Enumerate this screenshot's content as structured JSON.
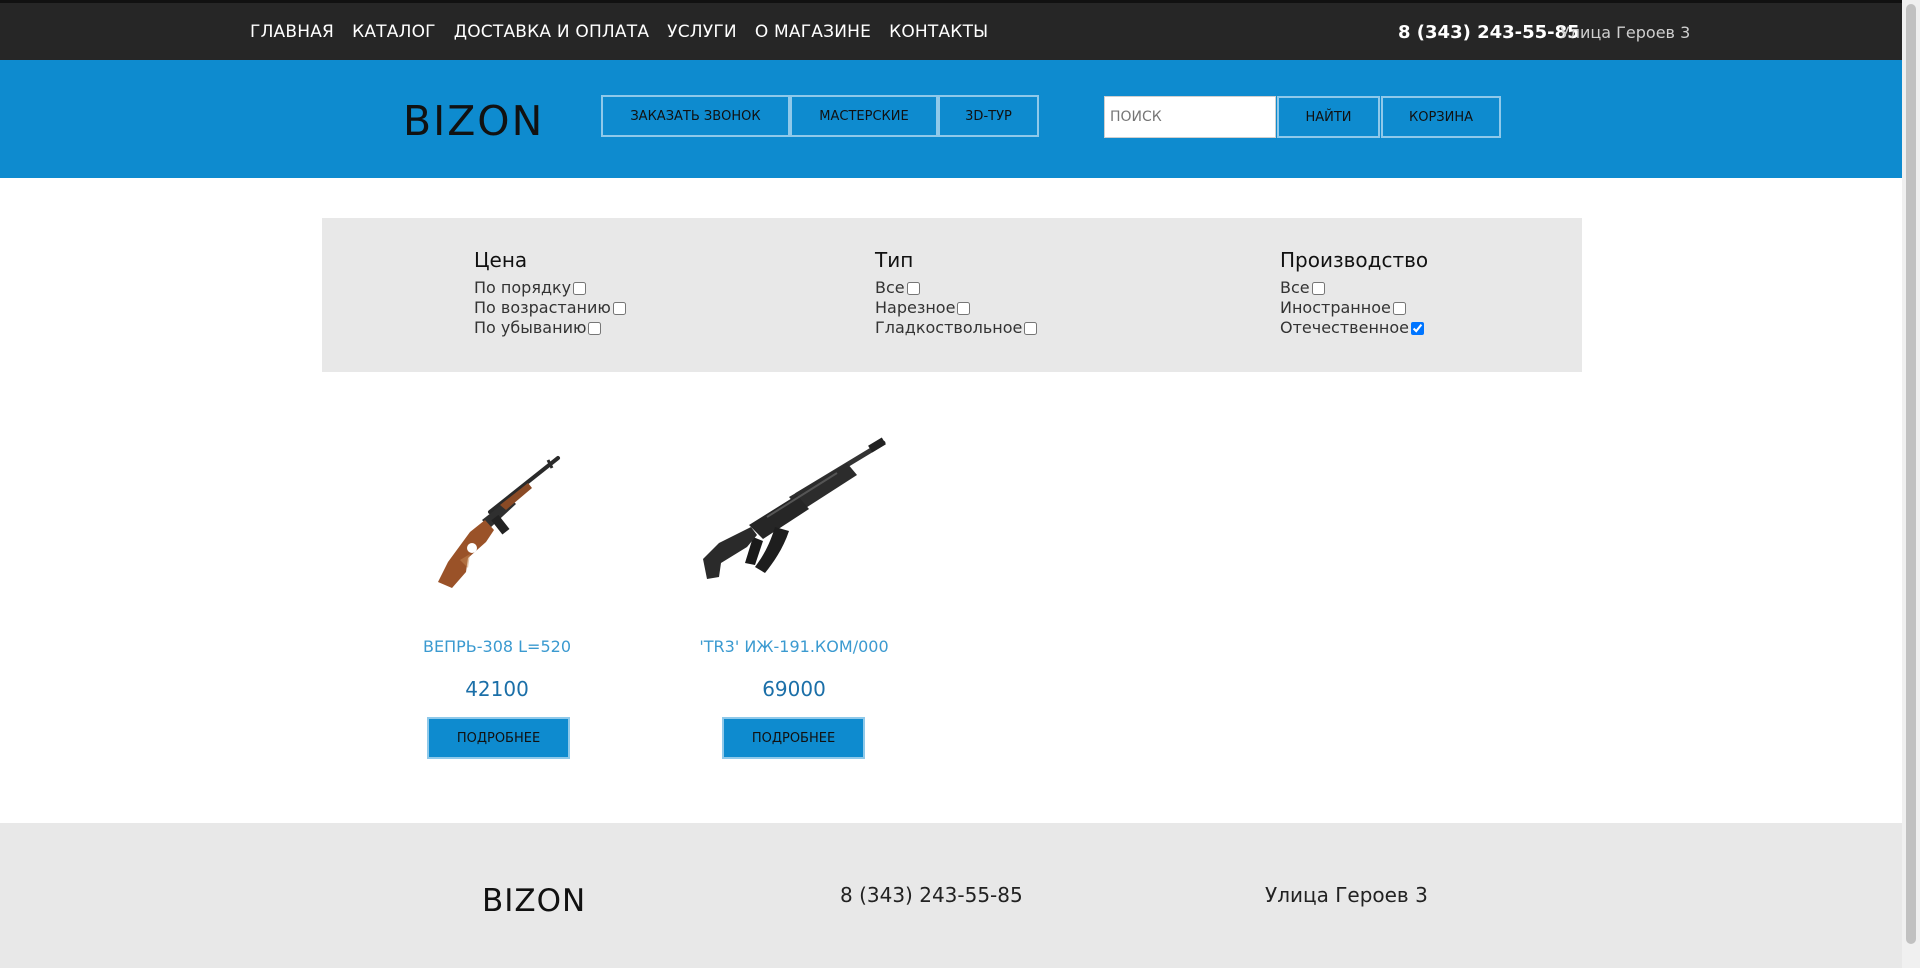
{
  "topnav": {
    "items": [
      "ГЛАВНАЯ",
      "КАТАЛОГ",
      "ДОСТАВКА И ОПЛАТА",
      "УСЛУГИ",
      "О МАГАЗИНЕ",
      "КОНТАКТЫ"
    ],
    "phone": "8 (343) 243-55-85",
    "address": "Улица Героев 3"
  },
  "header": {
    "logo": "BIZON",
    "buttons": [
      "ЗАКАЗАТЬ ЗВОНОК",
      "МАСТЕРСКИЕ",
      "3D-ТУР"
    ],
    "search_placeholder": "ПОИСК",
    "search_button": "НАЙТИ",
    "cart_button": "КОРЗИНА",
    "bg_color": "#0e8bcf"
  },
  "filters": {
    "price": {
      "title": "Цена",
      "options": [
        {
          "label": "По порядку",
          "checked": false
        },
        {
          "label": "По возрастанию",
          "checked": false
        },
        {
          "label": "По убыванию",
          "checked": false
        }
      ]
    },
    "type": {
      "title": "Тип",
      "options": [
        {
          "label": "Все",
          "checked": false
        },
        {
          "label": "Нарезное",
          "checked": false
        },
        {
          "label": "Гладкоствольное",
          "checked": false
        }
      ]
    },
    "origin": {
      "title": "Производство",
      "options": [
        {
          "label": "Все",
          "checked": false
        },
        {
          "label": "Иностранное",
          "checked": false
        },
        {
          "label": "Отечественное",
          "checked": true
        }
      ]
    }
  },
  "products": [
    {
      "name": "ВЕПРЬ-308 L=520",
      "price": "42100",
      "button": "ПОДРОБНЕЕ",
      "image": "hunting-rifle-wood-stock"
    },
    {
      "name": "'TR3' ИЖ-191.КОМ/000",
      "price": "69000",
      "button": "ПОДРОБНЕЕ",
      "image": "tactical-rifle-black"
    }
  ],
  "footer": {
    "logo": "BIZON",
    "phone": "8 (343) 243-55-85",
    "address": "Улица Героев 3"
  }
}
